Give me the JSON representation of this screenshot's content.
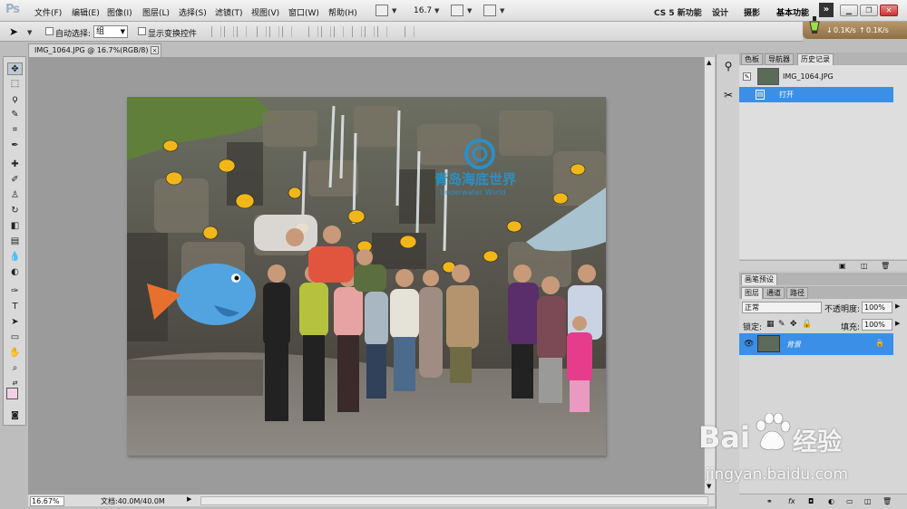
{
  "app": {
    "logo": "Ps"
  },
  "menu": [
    "文件(F)",
    "编辑(E)",
    "图像(I)",
    "图层(L)",
    "选择(S)",
    "滤镜(T)",
    "视图(V)",
    "窗口(W)",
    "帮助(H)"
  ],
  "appbar": {
    "zoom": "16.7"
  },
  "workspaces": {
    "new": "CS 5 新功能",
    "design": "设计",
    "photo": "摄影",
    "basic": "基本功能"
  },
  "speed": {
    "down": "0.1K/s",
    "up": "0.1K/s"
  },
  "options": {
    "auto_select_label": "自动选择:",
    "auto_select_value": "组",
    "show_transform_label": "显示变换控件"
  },
  "document": {
    "tab_title": "IMG_1064.JPG @ 16.7%(RGB/8)"
  },
  "photo_sign": {
    "cn": "青岛海底世界",
    "en": "Underwater World"
  },
  "status": {
    "zoom": "16.67%",
    "doc_size": "文档:40.0M/40.0M"
  },
  "panel_top": {
    "tabs": [
      "色板",
      "导航器",
      "历史记录"
    ],
    "snapshot": "IMG_1064.JPG",
    "history_item": "打开"
  },
  "brush_panel": {
    "tab": "画笔预设"
  },
  "layers_panel": {
    "tabs": [
      "图层",
      "通道",
      "路径"
    ],
    "blend_mode": "正常",
    "opacity_label": "不透明度:",
    "opacity_value": "100%",
    "lock_label": "锁定:",
    "fill_label": "填充:",
    "fill_value": "100%",
    "layer_name": "背景"
  },
  "watermark": {
    "brand_a": "Bai",
    "brand_b": "经验",
    "url": "jingyan.baidu.com"
  },
  "colors": {
    "selection": "#3c8fe6",
    "canvas_bg": "#9b9b9b",
    "fg_swatch": "#f3cfe6",
    "bg_swatch": "#ffffff"
  }
}
